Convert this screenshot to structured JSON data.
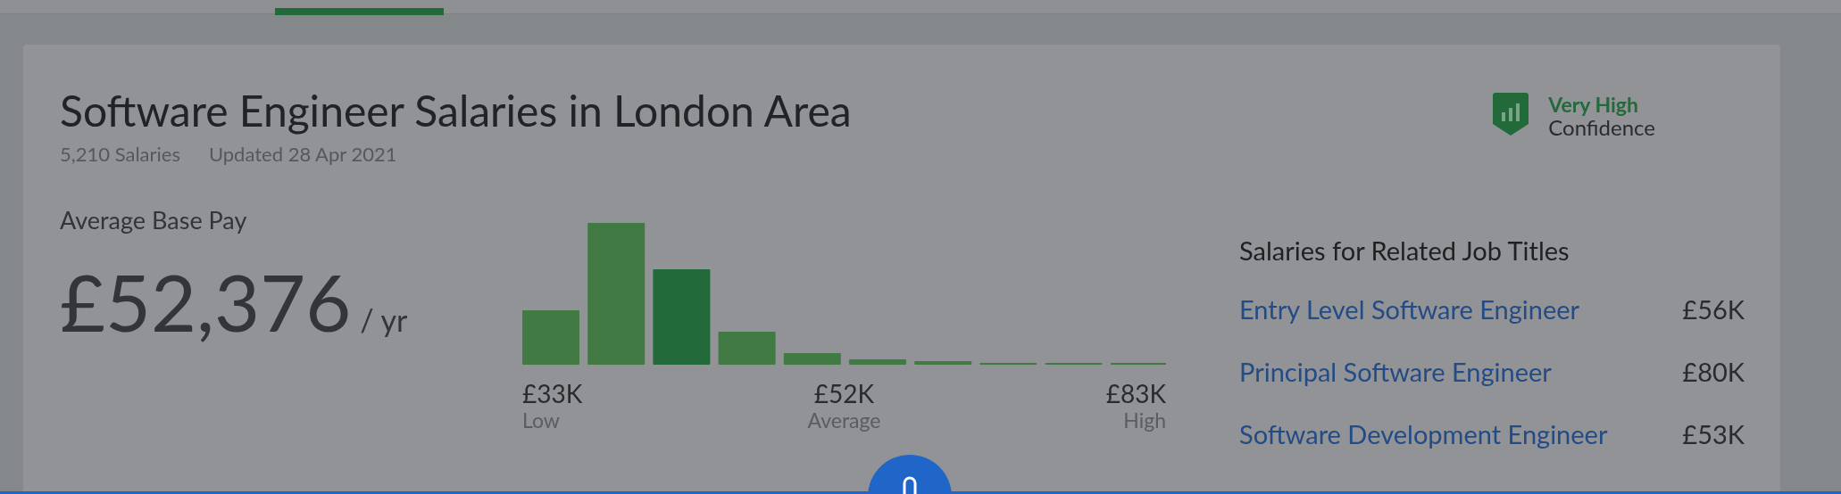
{
  "header": {
    "title": "Software Engineer Salaries in London Area",
    "salary_count": "5,210 Salaries",
    "updated": "Updated 28 Apr 2021"
  },
  "confidence": {
    "rating": "Very High",
    "label": "Confidence"
  },
  "average_base_pay": {
    "label": "Average Base Pay",
    "amount": "£52,376",
    "unit": "/ yr"
  },
  "histogram": {
    "range_labels": [
      {
        "value": "£33K",
        "label": "Low"
      },
      {
        "value": "£52K",
        "label": "Average"
      },
      {
        "value": "£83K",
        "label": "High"
      }
    ]
  },
  "related_titles": {
    "heading": "Salaries for Related Job Titles",
    "items": [
      {
        "title": "Entry Level Software Engineer",
        "pay": "£56K"
      },
      {
        "title": "Principal Software Engineer",
        "pay": "£80K"
      },
      {
        "title": "Software Development Engineer",
        "pay": "£53K"
      }
    ]
  }
}
